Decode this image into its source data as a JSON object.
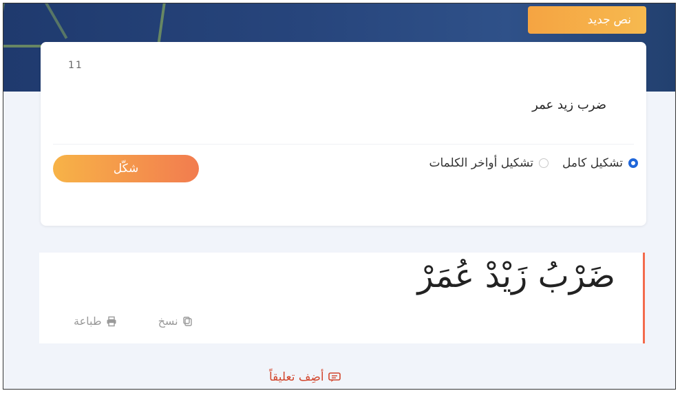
{
  "header": {
    "new_text_label": "نص جديد"
  },
  "input": {
    "char_count": "11",
    "value": "ضرب زيد عمر"
  },
  "options": [
    {
      "label": "تشكيل كامل",
      "selected": true
    },
    {
      "label": "تشكيل أواخر الكلمات",
      "selected": false
    }
  ],
  "actions": {
    "shakl_label": "شكّل"
  },
  "result": {
    "text": "ضَرْبُ زَيْدْ عُمَرْ",
    "copy_label": "نسخ",
    "print_label": "طباعة"
  },
  "comment": {
    "label": "أضِف تعليقاً"
  },
  "colors": {
    "accent": "#1f66d9",
    "orange": "#f5a442",
    "comment": "#d2452c"
  }
}
